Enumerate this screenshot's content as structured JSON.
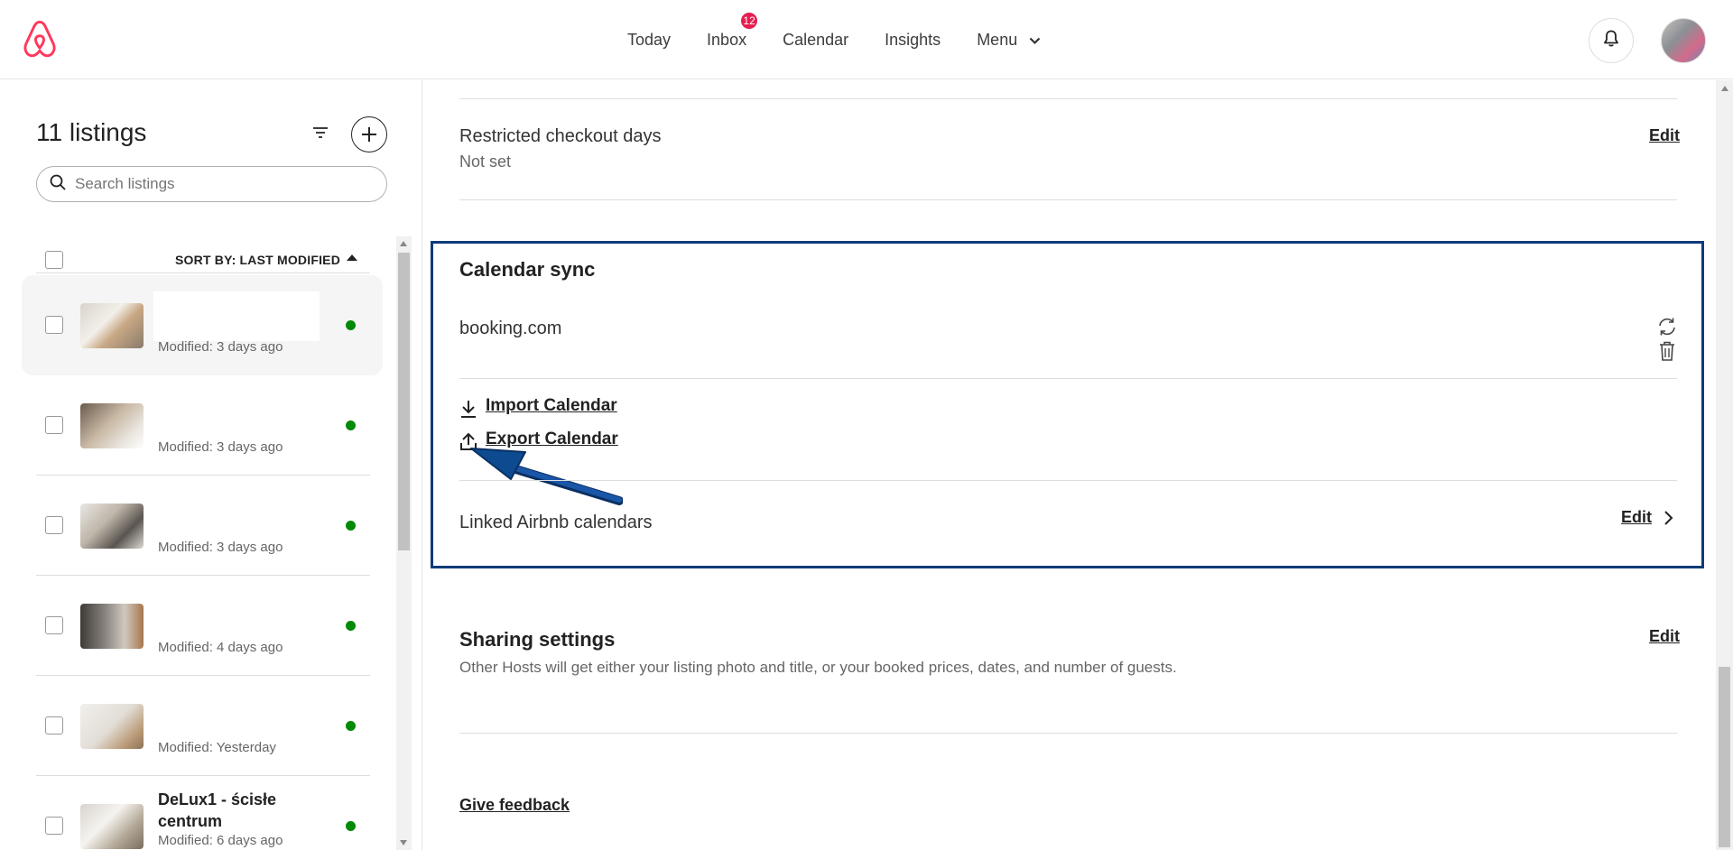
{
  "nav": {
    "items": [
      "Today",
      "Inbox",
      "Calendar",
      "Insights",
      "Menu"
    ],
    "inbox_badge": "12"
  },
  "sidebar": {
    "title": "11 listings",
    "search_placeholder": "Search listings",
    "sort_label": "SORT BY: LAST MODIFIED",
    "listings": [
      {
        "title": "",
        "modified": "Modified: 3 days ago",
        "status_color": "#008a05"
      },
      {
        "title": "",
        "modified": "Modified: 3 days ago",
        "status_color": "#008a05"
      },
      {
        "title": "",
        "modified": "Modified: 3 days ago",
        "status_color": "#008a05"
      },
      {
        "title": "",
        "modified": "Modified: 4 days ago",
        "status_color": "#008a05"
      },
      {
        "title": "",
        "modified": "Modified: Yesterday",
        "status_color": "#008a05"
      },
      {
        "title": "DeLux1 - ścisłe centrum",
        "modified": "Modified: 6 days ago",
        "status_color": "#008a05"
      }
    ]
  },
  "main": {
    "restricted": {
      "label": "Restricted checkout days",
      "value": "Not set",
      "edit": "Edit"
    },
    "calendar_sync": {
      "heading": "Calendar sync",
      "source": "booking.com",
      "import_label": "Import Calendar",
      "export_label": "Export Calendar",
      "linked_label": "Linked Airbnb calendars",
      "linked_edit": "Edit"
    },
    "sharing": {
      "heading": "Sharing settings",
      "description": "Other Hosts will get either your listing photo and title, or your booked prices, dates, and number of guests.",
      "edit": "Edit"
    },
    "feedback": "Give feedback"
  },
  "colors": {
    "brand": "#ff385c",
    "highlight_border": "#0d3b7a",
    "arrow": "#0d4a8f",
    "active_dot": "#008a05"
  }
}
